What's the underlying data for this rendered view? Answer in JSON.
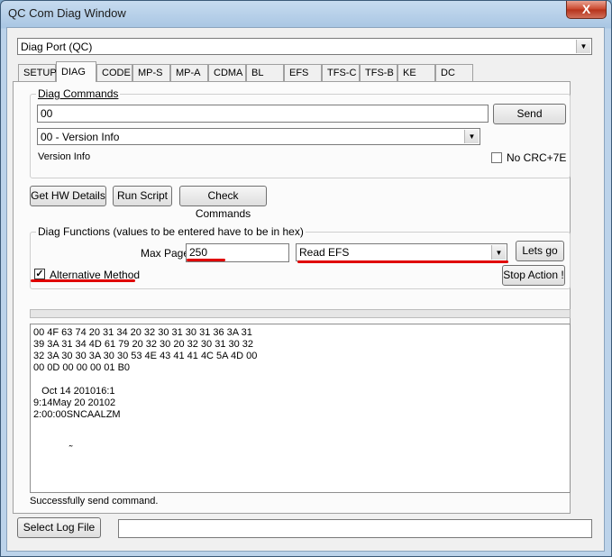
{
  "window": {
    "title": "QC Com Diag Window",
    "close_glyph": "X"
  },
  "port": {
    "selected": "Diag Port (QC)"
  },
  "tabs": [
    {
      "label": "SETUP"
    },
    {
      "label": "DIAG"
    },
    {
      "label": "CODE"
    },
    {
      "label": "MP-S"
    },
    {
      "label": "MP-A"
    },
    {
      "label": "CDMA"
    },
    {
      "label": "BL"
    },
    {
      "label": "EFS"
    },
    {
      "label": "TFS-C"
    },
    {
      "label": "TFS-B"
    },
    {
      "label": "KE"
    },
    {
      "label": "DC"
    }
  ],
  "diag_commands": {
    "legend": "Diag Commands",
    "command_value": "00",
    "send_label": "Send",
    "command_select": "00 - Version Info",
    "description": "Version Info",
    "no_crc_label": "No CRC+7E",
    "no_crc_checked": false
  },
  "actions": {
    "get_hw": "Get HW Details",
    "run_script": "Run Script",
    "check_commands": "Check Commands"
  },
  "diag_functions": {
    "legend": "Diag Functions (values to be entered have to be in hex)",
    "max_page_label": "Max Page",
    "max_page_value": "250",
    "function_select": "Read EFS",
    "lets_go": "Lets go",
    "alt_method_label": "Alternative Method",
    "alt_method_checked": true,
    "stop_action": "Stop Action !"
  },
  "log": {
    "text": "00 4F 63 74 20 31 34 20 32 30 31 30 31 36 3A 31\n39 3A 31 34 4D 61 79 20 32 30 20 32 30 31 30 32\n32 3A 30 30 3A 30 30 53 4E 43 41 41 4C 5A 4D 00\n00 0D 00 00 00 01 B0\n\n   Oct 14 201016:1\n9:14May 20 20102\n2:00:00SNCAALZM\n\n\n             ˜",
    "status": "Successfully send command."
  },
  "footer": {
    "select_log_label": "Select Log File",
    "log_path": ""
  },
  "colors": {
    "annotation": "#e00000"
  }
}
